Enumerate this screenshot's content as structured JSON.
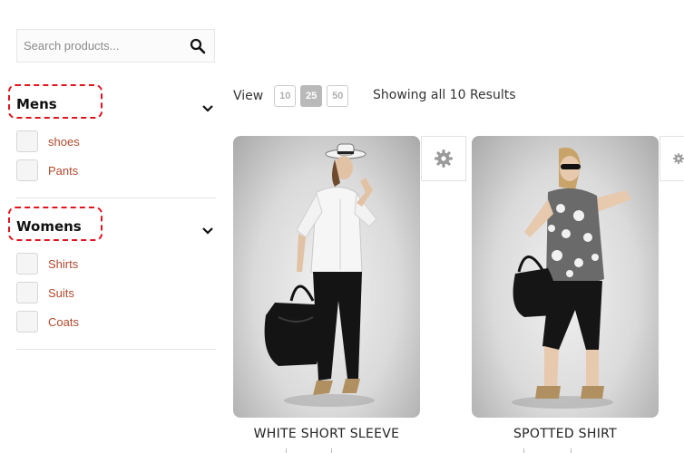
{
  "search": {
    "placeholder": "Search products...",
    "icon": "search-icon"
  },
  "filters": [
    {
      "title": "Mens",
      "items": [
        "shoes",
        "Pants"
      ]
    },
    {
      "title": "Womens",
      "items": [
        "Shirts",
        "Suits",
        "Coats"
      ]
    }
  ],
  "toolbar": {
    "view_label": "View",
    "per_page": [
      "10",
      "25",
      "50"
    ],
    "selected_per_page": "25",
    "results_text": "Showing all 10 Results"
  },
  "products": [
    {
      "name": "WHITE SHORT SLEEVE"
    },
    {
      "name": "SPOTTED SHIRT"
    }
  ],
  "colors": {
    "category_link": "#b24a2e",
    "highlight_dash": "#e0141e",
    "active_page": "#b9b9b9"
  }
}
